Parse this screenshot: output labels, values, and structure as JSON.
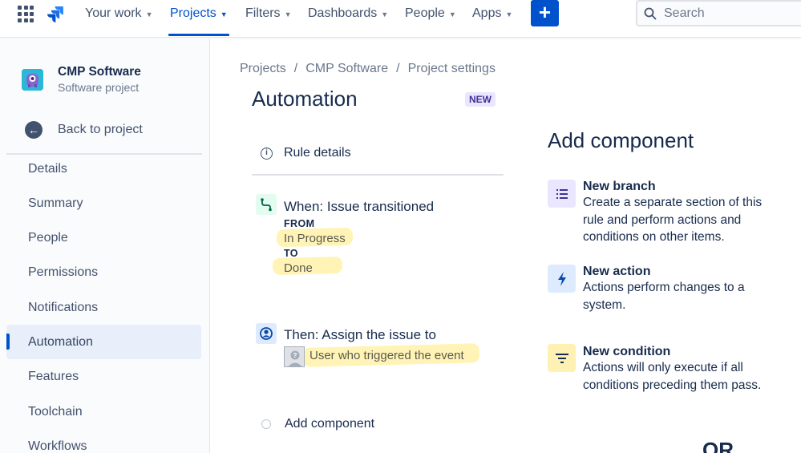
{
  "topnav": {
    "items": [
      {
        "label": "Your work"
      },
      {
        "label": "Projects"
      },
      {
        "label": "Filters"
      },
      {
        "label": "Dashboards"
      },
      {
        "label": "People"
      },
      {
        "label": "Apps"
      }
    ],
    "active_item": "Projects",
    "create_label": "+",
    "search_placeholder": "Search",
    "accent_color": "#0052cc"
  },
  "sidebar": {
    "project_name": "CMP Software",
    "project_type": "Software project",
    "back_label": "Back to project",
    "items": [
      {
        "label": "Details"
      },
      {
        "label": "Summary"
      },
      {
        "label": "People"
      },
      {
        "label": "Permissions"
      },
      {
        "label": "Notifications"
      },
      {
        "label": "Automation"
      },
      {
        "label": "Features"
      },
      {
        "label": "Toolchain"
      },
      {
        "label": "Workflows"
      }
    ],
    "selected_item": "Automation"
  },
  "main": {
    "breadcrumb": [
      "Projects",
      "/",
      "CMP Software",
      "/",
      "Project settings"
    ],
    "title": "Automation",
    "badge": "NEW",
    "rule_details_label": "Rule details",
    "trigger": {
      "title": "When: Issue transitioned",
      "from_label": "FROM",
      "from_value": "In Progress",
      "to_label": "TO",
      "to_value": "Done"
    },
    "action": {
      "title": "Then: Assign the issue to",
      "user_value": "User who triggered the event"
    },
    "add_component_label": "Add component"
  },
  "panel": {
    "title": "Add component",
    "components": [
      {
        "title": "New branch",
        "description": "Create a separate section of this rule and perform actions and conditions on other items.",
        "icon": "list-icon",
        "color": "#eae6ff"
      },
      {
        "title": "New action",
        "description": "Actions perform changes to a system.",
        "icon": "lightning-icon",
        "color": "#deebff"
      },
      {
        "title": "New condition",
        "description": "Actions will only execute if all conditions preceding them pass.",
        "icon": "filter-icon",
        "color": "#fff0b3"
      }
    ],
    "or_label": "OR"
  }
}
